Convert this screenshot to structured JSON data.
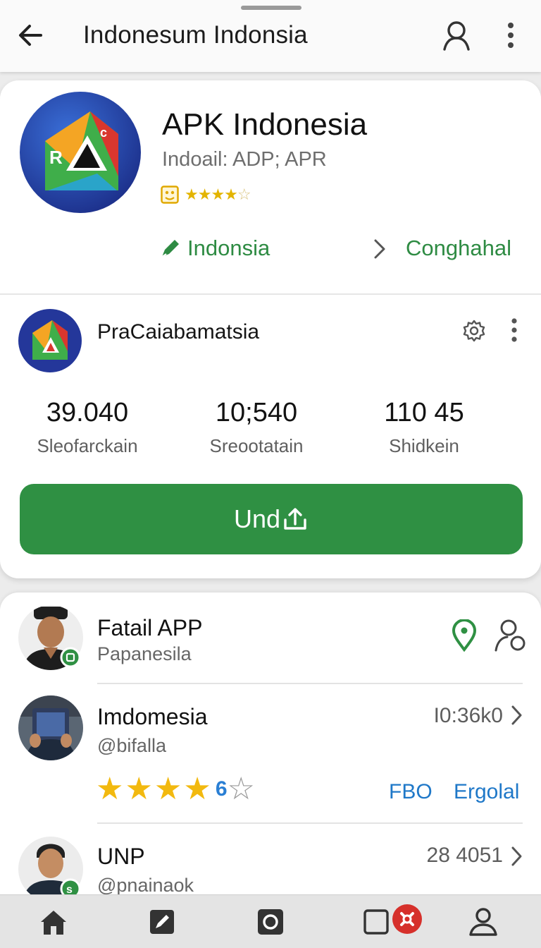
{
  "topbar": {
    "title": "Indonesum Indonsia",
    "back_icon": "arrow-left-icon",
    "account_icon": "account-icon",
    "more_icon": "more-vertical-icon"
  },
  "app": {
    "name": "APK Indonesia",
    "subtitle": "Indoail: ADP; APR",
    "rating_stars": 4,
    "rating_max": 5,
    "developer_link": "Indonsia",
    "secondary_link": "Conghahal"
  },
  "publisher": {
    "name": "PraCaiabamatsia",
    "stats": [
      {
        "value": "39.040",
        "label": "Sleofarckain"
      },
      {
        "value": "10;540",
        "label": "Sreootatain"
      },
      {
        "value": "110 45",
        "label": "Shidkein"
      }
    ],
    "cta_label": "Und"
  },
  "list": {
    "items": [
      {
        "title": "Fatail APP",
        "subtitle": "Papanesila"
      },
      {
        "title": "Imdomesia",
        "subtitle": "@bifalla",
        "meta": "I0:36k0",
        "stars": 4,
        "extra_glyph": "6",
        "links": [
          "FBO",
          "Ergolal"
        ]
      },
      {
        "title": "UNP",
        "subtitle": "@pnainaok",
        "meta": "28 4051"
      }
    ]
  },
  "nav": {
    "items": [
      "home-icon",
      "edit-icon",
      "camera-icon",
      "notifications-icon",
      "profile-icon"
    ]
  },
  "colors": {
    "accent_green": "#2f9043",
    "link_blue": "#1f78c8",
    "star_yellow": "#f2b90f"
  }
}
